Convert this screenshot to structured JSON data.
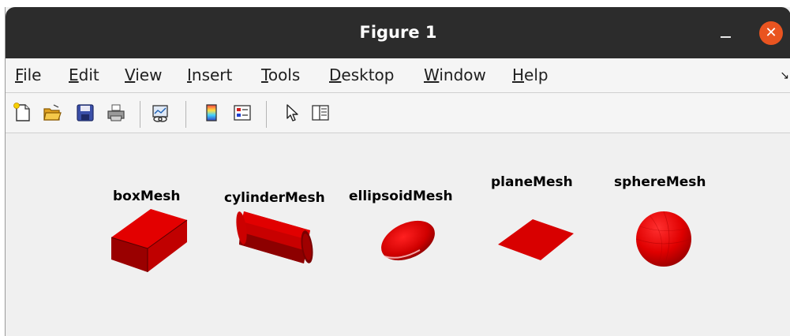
{
  "window": {
    "title": "Figure 1",
    "close_glyph": "✕"
  },
  "menu": {
    "items": [
      {
        "mnemonic": "F",
        "rest": "ile"
      },
      {
        "mnemonic": "E",
        "rest": "dit"
      },
      {
        "mnemonic": "V",
        "rest": "iew"
      },
      {
        "mnemonic": "I",
        "rest": "nsert"
      },
      {
        "mnemonic": "T",
        "rest": "ools"
      },
      {
        "mnemonic": "D",
        "rest": "esktop"
      },
      {
        "mnemonic": "W",
        "rest": "indow"
      },
      {
        "mnemonic": "H",
        "rest": "elp"
      }
    ],
    "overflow_glyph": "↘"
  },
  "toolbar": {
    "icons": [
      "new-figure-icon",
      "open-file-icon",
      "save-icon",
      "print-icon",
      "link-plot-icon",
      "colorbar-icon",
      "legend-icon",
      "pointer-icon",
      "property-inspector-icon"
    ]
  },
  "meshes": [
    {
      "label": "boxMesh",
      "color": "#dd0000"
    },
    {
      "label": "cylinderMesh",
      "color": "#dd0000"
    },
    {
      "label": "ellipsoidMesh",
      "color": "#dd0000"
    },
    {
      "label": "planeMesh",
      "color": "#dd0000"
    },
    {
      "label": "sphereMesh",
      "color": "#dd0000"
    }
  ],
  "colors": {
    "titlebar": "#2c2c2c",
    "close_button": "#e95420",
    "mesh_red": "#dd0000"
  }
}
